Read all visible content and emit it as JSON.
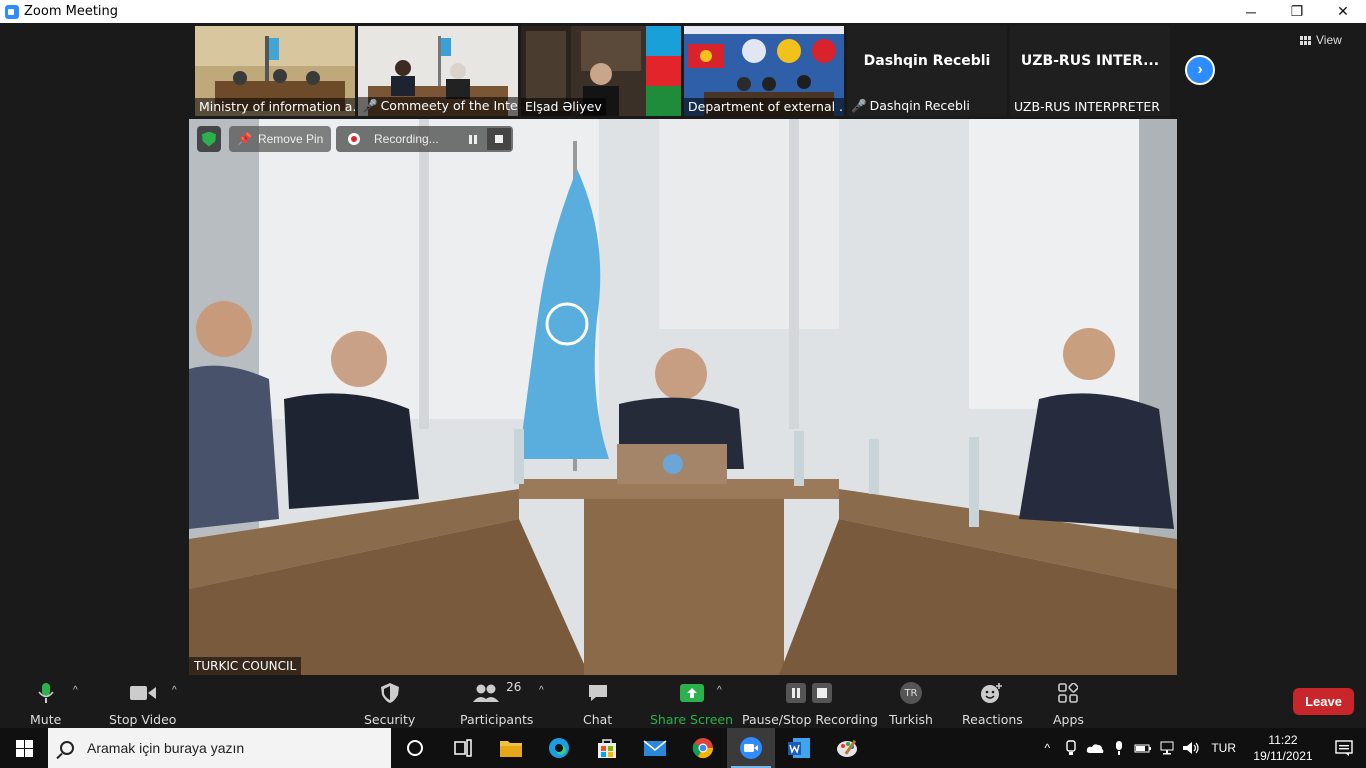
{
  "window": {
    "title": "Zoom Meeting",
    "minimize": "─",
    "restore": "❐",
    "close": "✕"
  },
  "filmstrip": {
    "tiles": [
      {
        "name": "Ministry of information a...",
        "muted": false
      },
      {
        "name": "Commeety of the Inte...",
        "muted": true
      },
      {
        "name": "Elşad Əliyev",
        "muted": false
      },
      {
        "name": "Department of external ...",
        "muted": false
      },
      {
        "name": "Dashqin Recebli",
        "big": "Dashqin Recebli",
        "muted": true
      },
      {
        "name": "UZB-RUS INTERPRETER",
        "big": "UZB-RUS INTER...",
        "muted": false
      }
    ],
    "next": "›",
    "view_label": "View"
  },
  "main_video": {
    "speaker": "TURKIC COUNCIL",
    "remove_pin": "Remove Pin",
    "recording": "Recording..."
  },
  "toolbar": {
    "mute": "Mute",
    "stop_video": "Stop Video",
    "security": "Security",
    "participants": "Participants",
    "participants_count": "26",
    "chat": "Chat",
    "share_screen": "Share Screen",
    "recording_ctl": "Pause/Stop Recording",
    "interpretation_badge": "TR",
    "interpretation": "Turkish",
    "reactions": "Reactions",
    "apps": "Apps",
    "leave": "Leave"
  },
  "taskbar": {
    "search_placeholder": "Aramak için buraya yazın",
    "lang": "TUR",
    "time": "11:22",
    "date": "19/11/2021"
  },
  "colors": {
    "accent_blue": "#2d8cff",
    "share_green": "#2bb24c",
    "leave_red": "#c8262a",
    "turkic_flag": "#5aaede"
  }
}
